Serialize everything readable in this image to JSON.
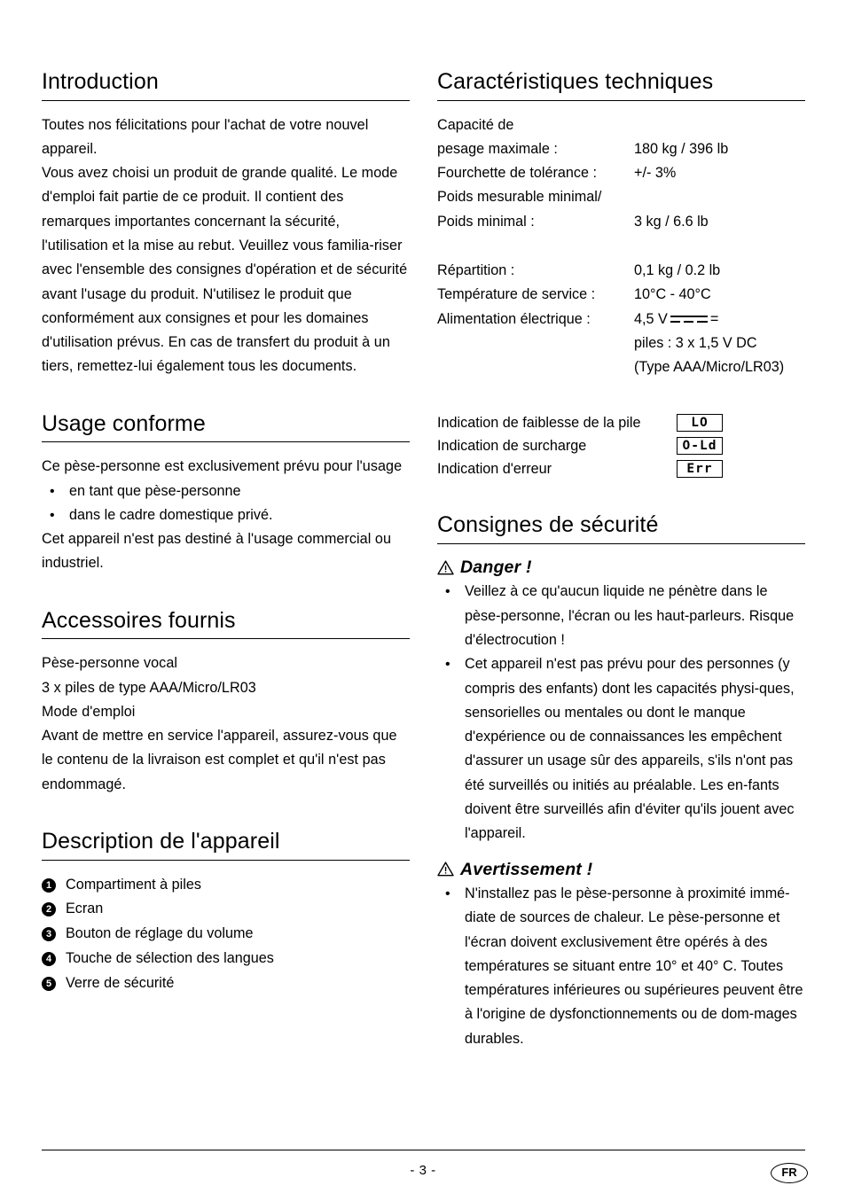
{
  "document": {
    "language_badge": "FR",
    "page_number": "- 3 -"
  },
  "left_column": {
    "introduction": {
      "heading": "Introduction",
      "paragraph_1": "Toutes nos félicitations pour l'achat de votre nouvel appareil.",
      "paragraph_2": "Vous avez choisi un produit de grande qualité. Le mode d'emploi fait partie de ce produit. Il contient des remarques importantes concernant la sécurité, l'utilisation et la mise au rebut. Veuillez vous familia-riser avec l'ensemble des consignes d'opération et de sécurité avant l'usage du produit. N'utilisez le produit que conformément aux consignes et pour les domaines d'utilisation prévus. En cas de transfert du produit à un tiers, remettez-lui également tous les documents."
    },
    "usage": {
      "heading": "Usage conforme",
      "intro": "Ce pèse-personne est exclusivement prévu pour l'usage",
      "bullets": [
        "en tant que pèse-personne",
        "dans le cadre domestique privé."
      ],
      "outro": "Cet appareil n'est pas destiné à l'usage commercial ou industriel."
    },
    "accessories": {
      "heading": "Accessoires fournis",
      "items": [
        "Pèse-personne vocal",
        "3 x piles de type AAA/Micro/LR03",
        "Mode d'emploi"
      ],
      "note": "Avant de mettre en service l'appareil, assurez-vous que le contenu de la livraison est complet et qu'il n'est pas endommagé."
    },
    "description": {
      "heading": "Description de l'appareil",
      "items": [
        {
          "number": "1",
          "label": "Compartiment à piles"
        },
        {
          "number": "2",
          "label": "Ecran"
        },
        {
          "number": "3",
          "label": "Bouton de réglage du volume"
        },
        {
          "number": "4",
          "label": "Touche de sélection des langues"
        },
        {
          "number": "5",
          "label": "Verre de sécurité"
        }
      ]
    }
  },
  "right_column": {
    "specs": {
      "heading": "Caractéristiques techniques",
      "rows": [
        {
          "label": "Capacité de",
          "value": ""
        },
        {
          "label": "pesage maximale :",
          "value": "180 kg / 396 lb"
        },
        {
          "label": "Fourchette de tolérance :",
          "value": "+/- 3%"
        },
        {
          "label": "Poids mesurable minimal/",
          "value": ""
        },
        {
          "label": "Poids minimal :",
          "value": "3 kg / 6.6 lb"
        }
      ],
      "rows2": [
        {
          "label": "Répartition :",
          "value": "0,1 kg / 0.2 lb"
        },
        {
          "label": "Température de service :",
          "value": "10°C - 40°C"
        }
      ],
      "power_label": "Alimentation électrique :",
      "power_value_prefix": "4,5 V",
      "power_value_suffix": "=",
      "power_line_2": "piles : 3 x 1,5 V DC",
      "power_line_3": "(Type AAA/Micro/LR03)",
      "indicators": [
        {
          "label": "Indication de faiblesse de la pile",
          "display": "LO"
        },
        {
          "label": "Indication de surcharge",
          "display": "O-Ld"
        },
        {
          "label": "Indication d'erreur",
          "display": "Err"
        }
      ]
    },
    "safety": {
      "heading": "Consignes de sécurité",
      "danger": {
        "title": "Danger !",
        "bullets": [
          "Veillez à ce qu'aucun liquide ne pénètre dans le pèse-personne, l'écran ou les haut-parleurs. Risque d'électrocution !",
          "Cet appareil n'est pas prévu pour des personnes (y compris des enfants) dont les capacités physi-ques, sensorielles ou mentales ou dont le manque d'expérience ou de connaissances les empêchent d'assurer un usage sûr des appareils, s'ils n'ont pas été surveillés ou initiés au préalable. Les en-fants doivent être surveillés afin d'éviter qu'ils jouent avec l'appareil."
        ]
      },
      "warning": {
        "title": "Avertissement !",
        "bullets": [
          "N'installez pas le pèse-personne à proximité immé-diate de sources de chaleur. Le pèse-personne et l'écran doivent exclusivement être opérés à des températures se situant entre 10° et 40° C. Toutes températures inférieures ou supérieures peuvent être à l'origine de dysfonctionnements ou de dom-mages durables."
        ]
      }
    }
  }
}
